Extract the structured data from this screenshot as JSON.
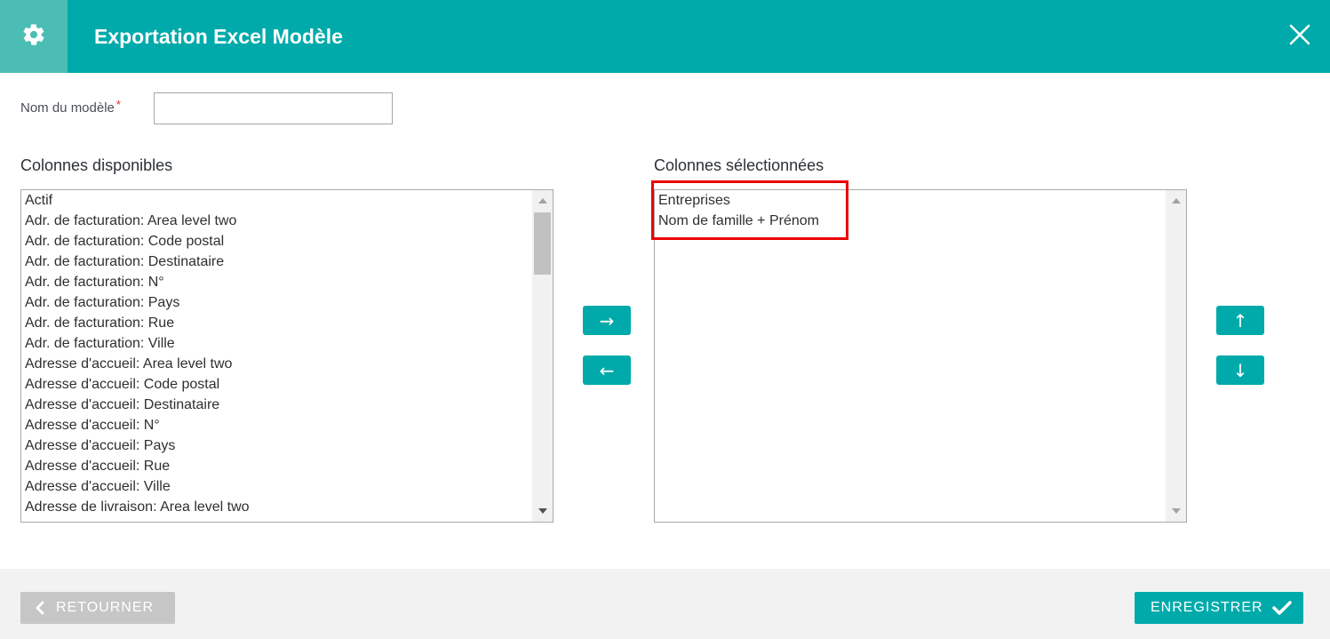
{
  "header": {
    "title": "Exportation Excel Modèle",
    "icon": "gear-icon",
    "close_icon": "close-icon"
  },
  "form": {
    "name_label": "Nom du modèle",
    "required_mark": "*",
    "name_value": "",
    "name_placeholder": ""
  },
  "available": {
    "label": "Colonnes disponibles",
    "items": [
      "Actif",
      "Adr. de facturation: Area level two",
      "Adr. de facturation: Code postal",
      "Adr. de facturation: Destinataire",
      "Adr. de facturation: N°",
      "Adr. de facturation: Pays",
      "Adr. de facturation: Rue",
      "Adr. de facturation: Ville",
      "Adresse d'accueil: Area level two",
      "Adresse d'accueil: Code postal",
      "Adresse d'accueil: Destinataire",
      "Adresse d'accueil: N°",
      "Adresse d'accueil: Pays",
      "Adresse d'accueil: Rue",
      "Adresse d'accueil: Ville",
      "Adresse de livraison: Area level two"
    ]
  },
  "selected": {
    "label": "Colonnes sélectionnées",
    "items": [
      "Entreprises",
      "Nom de famille + Prénom"
    ]
  },
  "transfer": {
    "add": "→",
    "remove": "←",
    "up": "↑",
    "down": "↓"
  },
  "footer": {
    "back_label": "RETOURNER",
    "save_label": "ENREGISTRER"
  },
  "colors": {
    "accent": "#00aaaa",
    "header_icon_bg": "#4cbdb4",
    "highlight": "#ea0000",
    "back_button": "#c6c6c6",
    "footer_bg": "#f2f2f2"
  }
}
